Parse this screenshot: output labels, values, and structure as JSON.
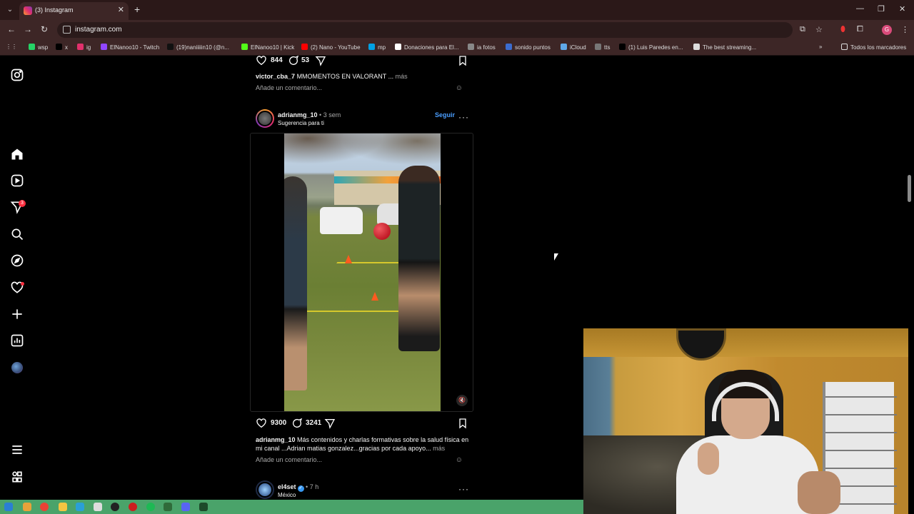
{
  "browser": {
    "tab_title": "(3) Instagram",
    "url": "instagram.com",
    "bookmarks": [
      {
        "label": "wsp",
        "color": "#25d366"
      },
      {
        "label": "x",
        "color": "#000000"
      },
      {
        "label": "ig",
        "color": "#e1306c"
      },
      {
        "label": "ElNanoo10 - Twitch",
        "color": "#9146ff"
      },
      {
        "label": "(19)naniiiiin10 (@n...",
        "color": "#111111"
      },
      {
        "label": "ElNanoo10 | Kick",
        "color": "#53fc18"
      },
      {
        "label": "(2) Nano - YouTube",
        "color": "#ff0000"
      },
      {
        "label": "mp",
        "color": "#00a1e4"
      },
      {
        "label": "Donaciones para El...",
        "color": "#ffffff"
      },
      {
        "label": "ia fotos",
        "color": "#888888"
      },
      {
        "label": "sonido puntos",
        "color": "#3b6ccf"
      },
      {
        "label": "iCloud",
        "color": "#5fa8e8"
      },
      {
        "label": "tts",
        "color": "#777777"
      },
      {
        "label": "(1) Luis Paredes en...",
        "color": "#000000"
      },
      {
        "label": "The best streaming...",
        "color": "#dddddd"
      }
    ],
    "all_bookmarks": "Todos los marcadores",
    "profile_initial": "G"
  },
  "nav": {
    "notification_count": "3"
  },
  "prev_post": {
    "likes": "844",
    "comments": "53",
    "caption_user": "victor_cba_7",
    "caption_text": "MMOMENTOS EN VALORANT ...",
    "more": "más",
    "comment_placeholder": "Añade un comentario..."
  },
  "post": {
    "username": "adrianmg_10",
    "time": "3 sem",
    "subtitle": "Sugerencia para ti",
    "follow": "Seguir",
    "likes": "9300",
    "comments": "3241",
    "caption_user": "adrianmg_10",
    "caption_text": "Más contenidos y charlas formativas sobre la salud física en mi canal ...Adrian matias gonzalez...gracias por cada apoyo...",
    "more": "más",
    "comment_placeholder": "Añade un comentario..."
  },
  "next_post": {
    "username": "el4set",
    "time": "7 h",
    "subtitle": "México"
  },
  "colors": {
    "link_blue": "#4a9eff",
    "badge_red": "#ff3040",
    "taskbar_green": "#4aa36a"
  }
}
